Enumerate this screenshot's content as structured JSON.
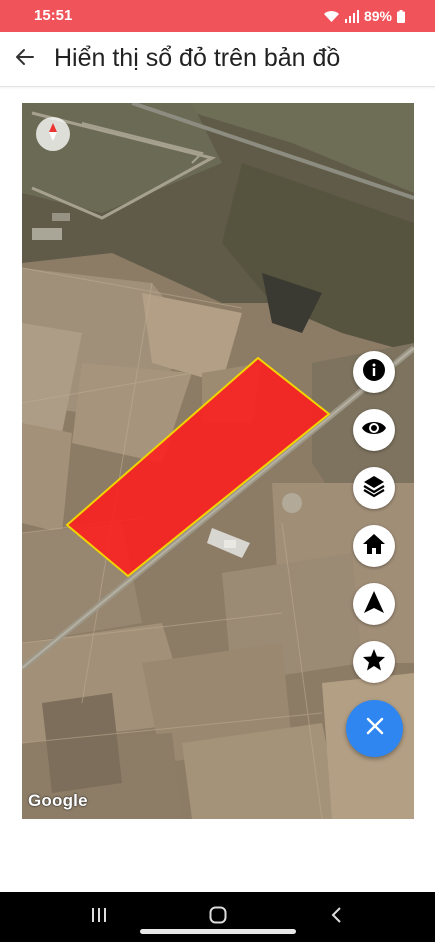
{
  "status_bar": {
    "time": "15:51",
    "battery": "89%",
    "icons": [
      "wifi-icon",
      "signal-icon",
      "battery-icon"
    ]
  },
  "app_bar": {
    "title": "Hiển thị sổ đỏ trên bản đồ",
    "back_icon": "arrow-left-icon"
  },
  "map": {
    "type": "satellite",
    "attribution": "Google",
    "parcel_fill": "#ff1e1e",
    "parcel_border": "#f2d400",
    "controls": [
      "info-icon",
      "eye-icon",
      "layers-icon",
      "home-icon",
      "navigation-icon",
      "star-icon"
    ],
    "main_fab_icon": "close-icon"
  },
  "colors": {
    "status_bar": "#f0545a",
    "fab": "#2f86f0",
    "parcel": "#ff1e1e"
  },
  "nav_bar": {
    "buttons": [
      "recent-apps-icon",
      "home-circle-icon",
      "back-chevron-icon"
    ]
  }
}
